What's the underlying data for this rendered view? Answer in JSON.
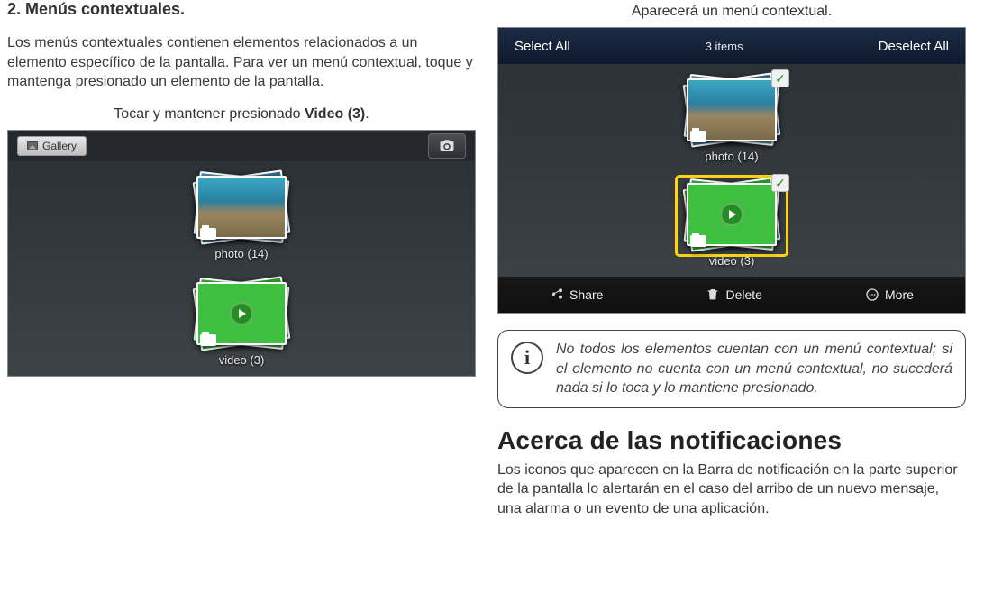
{
  "left": {
    "heading": "2.   Menús contextuales.",
    "para1": "Los menús contextuales contienen elementos relacionados a un elemento específico de la pantalla. Para ver un menú contextual, toque y mantenga presionado un elemento de la pantalla.",
    "caption_pre": "Tocar y mantener presionado ",
    "caption_bold": "Video (3)",
    "caption_post": ".",
    "gallery": {
      "chip_label": "Gallery",
      "photo_label": "photo  (14)",
      "video_label": "video  (3)"
    }
  },
  "right": {
    "caption_top": "Aparecerá un menú contextual.",
    "topbar": {
      "left": "Select All",
      "center": "3 items",
      "right": "Deselect All"
    },
    "thumbs": {
      "photo_label": "photo  (14)",
      "video_label": "video  (3)"
    },
    "bottombar": {
      "share": "Share",
      "delete": "Delete",
      "more": "More"
    },
    "info_text": "No todos los elementos cuentan con un menú contextual; si el elemento no cuenta con un menú contextual, no sucederá nada si lo toca y lo mantiene presionado.",
    "big_heading": "Acerca de las notificaciones",
    "para_bottom": "Los iconos que aparecen en la Barra de notificación en la parte superior de la pantalla lo alertarán en el caso del arribo de un nuevo mensaje, una alarma o un evento de una aplicación."
  }
}
